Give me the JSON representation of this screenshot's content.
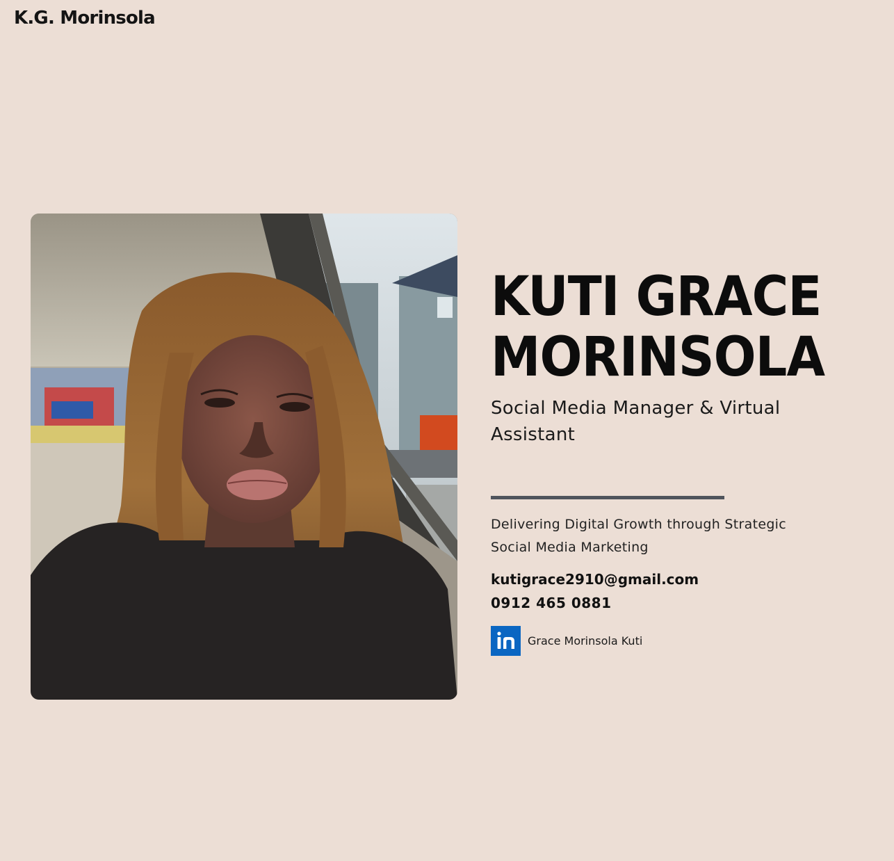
{
  "header": {
    "logo_text": "K.G. Morinsola"
  },
  "profile": {
    "photo_icon": "profile-photo",
    "name": "KUTI GRACE MORINSOLA",
    "role": "Social Media Manager & Virtual Assistant",
    "tagline": "Delivering Digital Growth through Strategic Social Media Marketing",
    "email": "kutigrace2910@gmail.com",
    "phone": "0912 465 0881",
    "linkedin": {
      "icon": "linkedin-icon",
      "label": "Grace Morinsola Kuti"
    }
  },
  "colors": {
    "background": "#ecded5",
    "divider": "#4f545c",
    "linkedin_blue": "#0a66c2"
  }
}
